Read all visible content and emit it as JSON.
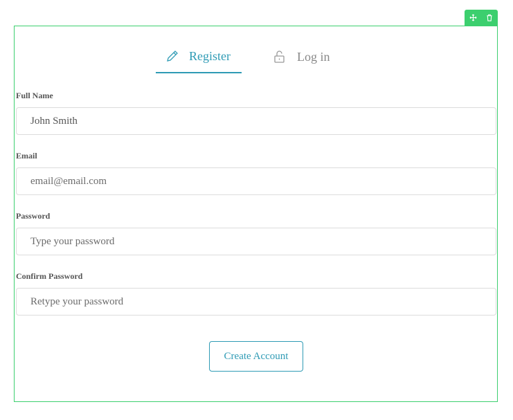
{
  "toolbar": {
    "move_icon": "move-arrows-icon",
    "delete_icon": "trash-icon",
    "color": "#3ccf6e"
  },
  "tabs": [
    {
      "label": "Register",
      "icon": "pencil-icon",
      "active": true
    },
    {
      "label": "Log in",
      "icon": "unlock-icon",
      "active": false
    }
  ],
  "form": {
    "full_name": {
      "label": "Full Name",
      "value": "John Smith",
      "placeholder": ""
    },
    "email": {
      "label": "Email",
      "value": "",
      "placeholder": "email@email.com"
    },
    "password": {
      "label": "Password",
      "value": "",
      "placeholder": "Type your password"
    },
    "confirm_password": {
      "label": "Confirm Password",
      "value": "",
      "placeholder": "Retype your password"
    },
    "submit_label": "Create Account"
  },
  "colors": {
    "accent": "#2f9bb5",
    "frame": "#3ccf6e"
  }
}
